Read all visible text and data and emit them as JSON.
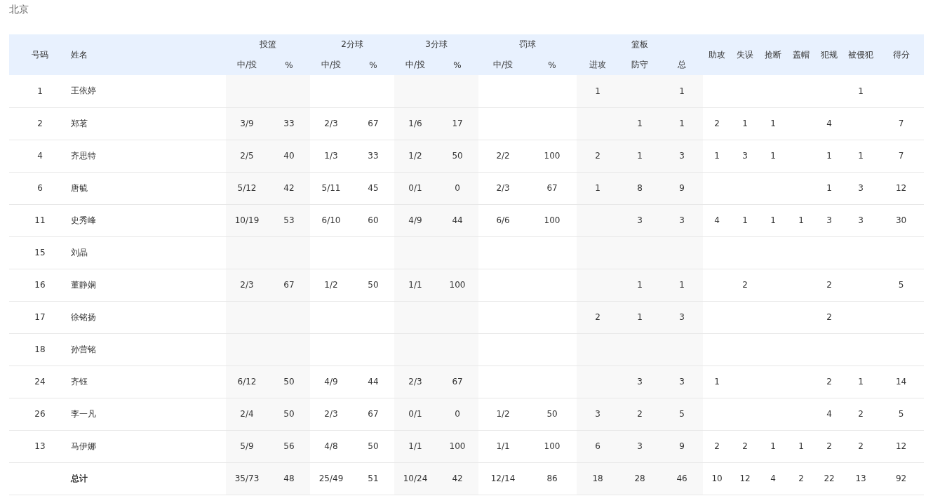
{
  "team": "北京",
  "columns": [
    {
      "kind": "number",
      "label": "号码"
    },
    {
      "kind": "name",
      "label": "姓名"
    },
    {
      "kind": "group",
      "label": "投篮",
      "sub": [
        "中/投",
        "%"
      ]
    },
    {
      "kind": "group",
      "label": "2分球",
      "sub": [
        "中/投",
        "%"
      ]
    },
    {
      "kind": "group",
      "label": "3分球",
      "sub": [
        "中/投",
        "%"
      ]
    },
    {
      "kind": "group",
      "label": "罚球",
      "sub": [
        "中/投",
        "%"
      ]
    },
    {
      "kind": "group",
      "label": "篮板",
      "sub": [
        "进攻",
        "防守",
        "总"
      ]
    },
    {
      "kind": "stat",
      "label": "助攻"
    },
    {
      "kind": "stat",
      "label": "失误"
    },
    {
      "kind": "stat",
      "label": "抢断"
    },
    {
      "kind": "stat",
      "label": "盖帽"
    },
    {
      "kind": "stat",
      "label": "犯规"
    },
    {
      "kind": "stat",
      "label": "被侵犯"
    },
    {
      "kind": "stat",
      "label": "得分"
    }
  ],
  "rows": [
    {
      "kind": "player",
      "number": "1",
      "name": "王依婷",
      "stats": [
        {
          "kind": "blank"
        },
        {
          "kind": "blank"
        },
        {
          "kind": "blank"
        },
        {
          "kind": "blank"
        },
        {
          "kind": "blank"
        },
        {
          "kind": "blank"
        },
        {
          "kind": "blank"
        },
        {
          "kind": "blank"
        },
        {
          "kind": "value",
          "text": "1"
        },
        {
          "kind": "blank"
        },
        {
          "kind": "value",
          "text": "1"
        },
        {
          "kind": "blank"
        },
        {
          "kind": "blank"
        },
        {
          "kind": "blank"
        },
        {
          "kind": "blank"
        },
        {
          "kind": "blank"
        },
        {
          "kind": "value",
          "text": "1"
        },
        {
          "kind": "blank"
        }
      ]
    },
    {
      "kind": "player",
      "number": "2",
      "name": "郑茗",
      "stats": [
        {
          "kind": "value",
          "text": "3/9"
        },
        {
          "kind": "value",
          "text": "33"
        },
        {
          "kind": "value",
          "text": "2/3"
        },
        {
          "kind": "value",
          "text": "67"
        },
        {
          "kind": "value",
          "text": "1/6"
        },
        {
          "kind": "value",
          "text": "17"
        },
        {
          "kind": "blank"
        },
        {
          "kind": "blank"
        },
        {
          "kind": "blank"
        },
        {
          "kind": "value",
          "text": "1"
        },
        {
          "kind": "value",
          "text": "1"
        },
        {
          "kind": "value",
          "text": "2"
        },
        {
          "kind": "value",
          "text": "1"
        },
        {
          "kind": "value",
          "text": "1"
        },
        {
          "kind": "blank"
        },
        {
          "kind": "value",
          "text": "4"
        },
        {
          "kind": "blank"
        },
        {
          "kind": "value",
          "text": "7"
        }
      ]
    },
    {
      "kind": "player",
      "number": "4",
      "name": "齐思特",
      "stats": [
        {
          "kind": "value",
          "text": "2/5"
        },
        {
          "kind": "value",
          "text": "40"
        },
        {
          "kind": "value",
          "text": "1/3"
        },
        {
          "kind": "value",
          "text": "33"
        },
        {
          "kind": "value",
          "text": "1/2"
        },
        {
          "kind": "value",
          "text": "50"
        },
        {
          "kind": "value",
          "text": "2/2"
        },
        {
          "kind": "value",
          "text": "100"
        },
        {
          "kind": "value",
          "text": "2"
        },
        {
          "kind": "value",
          "text": "1"
        },
        {
          "kind": "value",
          "text": "3"
        },
        {
          "kind": "value",
          "text": "1"
        },
        {
          "kind": "value",
          "text": "3"
        },
        {
          "kind": "value",
          "text": "1"
        },
        {
          "kind": "blank"
        },
        {
          "kind": "value",
          "text": "1"
        },
        {
          "kind": "value",
          "text": "1"
        },
        {
          "kind": "value",
          "text": "7"
        }
      ]
    },
    {
      "kind": "player",
      "number": "6",
      "name": "唐毓",
      "stats": [
        {
          "kind": "value",
          "text": "5/12"
        },
        {
          "kind": "value",
          "text": "42"
        },
        {
          "kind": "value",
          "text": "5/11"
        },
        {
          "kind": "value",
          "text": "45"
        },
        {
          "kind": "value",
          "text": "0/1"
        },
        {
          "kind": "value",
          "text": "0"
        },
        {
          "kind": "value",
          "text": "2/3"
        },
        {
          "kind": "value",
          "text": "67"
        },
        {
          "kind": "value",
          "text": "1"
        },
        {
          "kind": "value",
          "text": "8"
        },
        {
          "kind": "value",
          "text": "9"
        },
        {
          "kind": "blank"
        },
        {
          "kind": "blank"
        },
        {
          "kind": "blank"
        },
        {
          "kind": "blank"
        },
        {
          "kind": "value",
          "text": "1"
        },
        {
          "kind": "value",
          "text": "3"
        },
        {
          "kind": "value",
          "text": "12"
        }
      ]
    },
    {
      "kind": "player",
      "number": "11",
      "name": "史秀峰",
      "stats": [
        {
          "kind": "value",
          "text": "10/19"
        },
        {
          "kind": "value",
          "text": "53"
        },
        {
          "kind": "value",
          "text": "6/10"
        },
        {
          "kind": "value",
          "text": "60"
        },
        {
          "kind": "value",
          "text": "4/9"
        },
        {
          "kind": "value",
          "text": "44"
        },
        {
          "kind": "value",
          "text": "6/6"
        },
        {
          "kind": "value",
          "text": "100"
        },
        {
          "kind": "blank"
        },
        {
          "kind": "value",
          "text": "3"
        },
        {
          "kind": "value",
          "text": "3"
        },
        {
          "kind": "value",
          "text": "4"
        },
        {
          "kind": "value",
          "text": "1"
        },
        {
          "kind": "value",
          "text": "1"
        },
        {
          "kind": "value",
          "text": "1"
        },
        {
          "kind": "value",
          "text": "3"
        },
        {
          "kind": "value",
          "text": "3"
        },
        {
          "kind": "value",
          "text": "30"
        }
      ]
    },
    {
      "kind": "player",
      "number": "15",
      "name": "刘晶",
      "stats": [
        {
          "kind": "blank"
        },
        {
          "kind": "blank"
        },
        {
          "kind": "blank"
        },
        {
          "kind": "blank"
        },
        {
          "kind": "blank"
        },
        {
          "kind": "blank"
        },
        {
          "kind": "blank"
        },
        {
          "kind": "blank"
        },
        {
          "kind": "blank"
        },
        {
          "kind": "blank"
        },
        {
          "kind": "blank"
        },
        {
          "kind": "blank"
        },
        {
          "kind": "blank"
        },
        {
          "kind": "blank"
        },
        {
          "kind": "blank"
        },
        {
          "kind": "blank"
        },
        {
          "kind": "blank"
        },
        {
          "kind": "blank"
        }
      ]
    },
    {
      "kind": "player",
      "number": "16",
      "name": "董静娴",
      "stats": [
        {
          "kind": "value",
          "text": "2/3"
        },
        {
          "kind": "value",
          "text": "67"
        },
        {
          "kind": "value",
          "text": "1/2"
        },
        {
          "kind": "value",
          "text": "50"
        },
        {
          "kind": "value",
          "text": "1/1"
        },
        {
          "kind": "value",
          "text": "100"
        },
        {
          "kind": "blank"
        },
        {
          "kind": "blank"
        },
        {
          "kind": "blank"
        },
        {
          "kind": "value",
          "text": "1"
        },
        {
          "kind": "value",
          "text": "1"
        },
        {
          "kind": "blank"
        },
        {
          "kind": "value",
          "text": "2"
        },
        {
          "kind": "blank"
        },
        {
          "kind": "blank"
        },
        {
          "kind": "value",
          "text": "2"
        },
        {
          "kind": "blank"
        },
        {
          "kind": "value",
          "text": "5"
        }
      ]
    },
    {
      "kind": "player",
      "number": "17",
      "name": "徐铭扬",
      "stats": [
        {
          "kind": "blank"
        },
        {
          "kind": "blank"
        },
        {
          "kind": "blank"
        },
        {
          "kind": "blank"
        },
        {
          "kind": "blank"
        },
        {
          "kind": "blank"
        },
        {
          "kind": "blank"
        },
        {
          "kind": "blank"
        },
        {
          "kind": "value",
          "text": "2"
        },
        {
          "kind": "value",
          "text": "1"
        },
        {
          "kind": "value",
          "text": "3"
        },
        {
          "kind": "blank"
        },
        {
          "kind": "blank"
        },
        {
          "kind": "blank"
        },
        {
          "kind": "blank"
        },
        {
          "kind": "value",
          "text": "2"
        },
        {
          "kind": "blank"
        },
        {
          "kind": "blank"
        }
      ]
    },
    {
      "kind": "player",
      "number": "18",
      "name": "孙营铭",
      "stats": [
        {
          "kind": "blank"
        },
        {
          "kind": "blank"
        },
        {
          "kind": "blank"
        },
        {
          "kind": "blank"
        },
        {
          "kind": "blank"
        },
        {
          "kind": "blank"
        },
        {
          "kind": "blank"
        },
        {
          "kind": "blank"
        },
        {
          "kind": "blank"
        },
        {
          "kind": "blank"
        },
        {
          "kind": "blank"
        },
        {
          "kind": "blank"
        },
        {
          "kind": "blank"
        },
        {
          "kind": "blank"
        },
        {
          "kind": "blank"
        },
        {
          "kind": "blank"
        },
        {
          "kind": "blank"
        },
        {
          "kind": "blank"
        }
      ]
    },
    {
      "kind": "player",
      "number": "24",
      "name": "齐钰",
      "stats": [
        {
          "kind": "value",
          "text": "6/12"
        },
        {
          "kind": "value",
          "text": "50"
        },
        {
          "kind": "value",
          "text": "4/9"
        },
        {
          "kind": "value",
          "text": "44"
        },
        {
          "kind": "value",
          "text": "2/3"
        },
        {
          "kind": "value",
          "text": "67"
        },
        {
          "kind": "blank"
        },
        {
          "kind": "blank"
        },
        {
          "kind": "blank"
        },
        {
          "kind": "value",
          "text": "3"
        },
        {
          "kind": "value",
          "text": "3"
        },
        {
          "kind": "value",
          "text": "1"
        },
        {
          "kind": "blank"
        },
        {
          "kind": "blank"
        },
        {
          "kind": "blank"
        },
        {
          "kind": "value",
          "text": "2"
        },
        {
          "kind": "value",
          "text": "1"
        },
        {
          "kind": "value",
          "text": "14"
        }
      ]
    },
    {
      "kind": "player",
      "number": "26",
      "name": "李一凡",
      "stats": [
        {
          "kind": "value",
          "text": "2/4"
        },
        {
          "kind": "value",
          "text": "50"
        },
        {
          "kind": "value",
          "text": "2/3"
        },
        {
          "kind": "value",
          "text": "67"
        },
        {
          "kind": "value",
          "text": "0/1"
        },
        {
          "kind": "value",
          "text": "0"
        },
        {
          "kind": "value",
          "text": "1/2"
        },
        {
          "kind": "value",
          "text": "50"
        },
        {
          "kind": "value",
          "text": "3"
        },
        {
          "kind": "value",
          "text": "2"
        },
        {
          "kind": "value",
          "text": "5"
        },
        {
          "kind": "blank"
        },
        {
          "kind": "blank"
        },
        {
          "kind": "blank"
        },
        {
          "kind": "blank"
        },
        {
          "kind": "value",
          "text": "4"
        },
        {
          "kind": "value",
          "text": "2"
        },
        {
          "kind": "value",
          "text": "5"
        }
      ]
    },
    {
      "kind": "player",
      "number": "13",
      "name": "马伊娜",
      "stats": [
        {
          "kind": "value",
          "text": "5/9"
        },
        {
          "kind": "value",
          "text": "56"
        },
        {
          "kind": "value",
          "text": "4/8"
        },
        {
          "kind": "value",
          "text": "50"
        },
        {
          "kind": "value",
          "text": "1/1"
        },
        {
          "kind": "value",
          "text": "100"
        },
        {
          "kind": "value",
          "text": "1/1"
        },
        {
          "kind": "value",
          "text": "100"
        },
        {
          "kind": "value",
          "text": "6"
        },
        {
          "kind": "value",
          "text": "3"
        },
        {
          "kind": "value",
          "text": "9"
        },
        {
          "kind": "value",
          "text": "2"
        },
        {
          "kind": "value",
          "text": "2"
        },
        {
          "kind": "value",
          "text": "1"
        },
        {
          "kind": "value",
          "text": "1"
        },
        {
          "kind": "value",
          "text": "2"
        },
        {
          "kind": "value",
          "text": "2"
        },
        {
          "kind": "value",
          "text": "12"
        }
      ]
    },
    {
      "kind": "total",
      "name": "总计",
      "stats": [
        {
          "kind": "value",
          "text": "35/73"
        },
        {
          "kind": "value",
          "text": "48"
        },
        {
          "kind": "value",
          "text": "25/49"
        },
        {
          "kind": "value",
          "text": "51"
        },
        {
          "kind": "value",
          "text": "10/24"
        },
        {
          "kind": "value",
          "text": "42"
        },
        {
          "kind": "value",
          "text": "12/14"
        },
        {
          "kind": "value",
          "text": "86"
        },
        {
          "kind": "value",
          "text": "18"
        },
        {
          "kind": "value",
          "text": "28"
        },
        {
          "kind": "value",
          "text": "46"
        },
        {
          "kind": "value",
          "text": "10"
        },
        {
          "kind": "value",
          "text": "12"
        },
        {
          "kind": "value",
          "text": "4"
        },
        {
          "kind": "value",
          "text": "2"
        },
        {
          "kind": "value",
          "text": "22"
        },
        {
          "kind": "value",
          "text": "13"
        },
        {
          "kind": "value",
          "text": "92"
        }
      ]
    }
  ]
}
